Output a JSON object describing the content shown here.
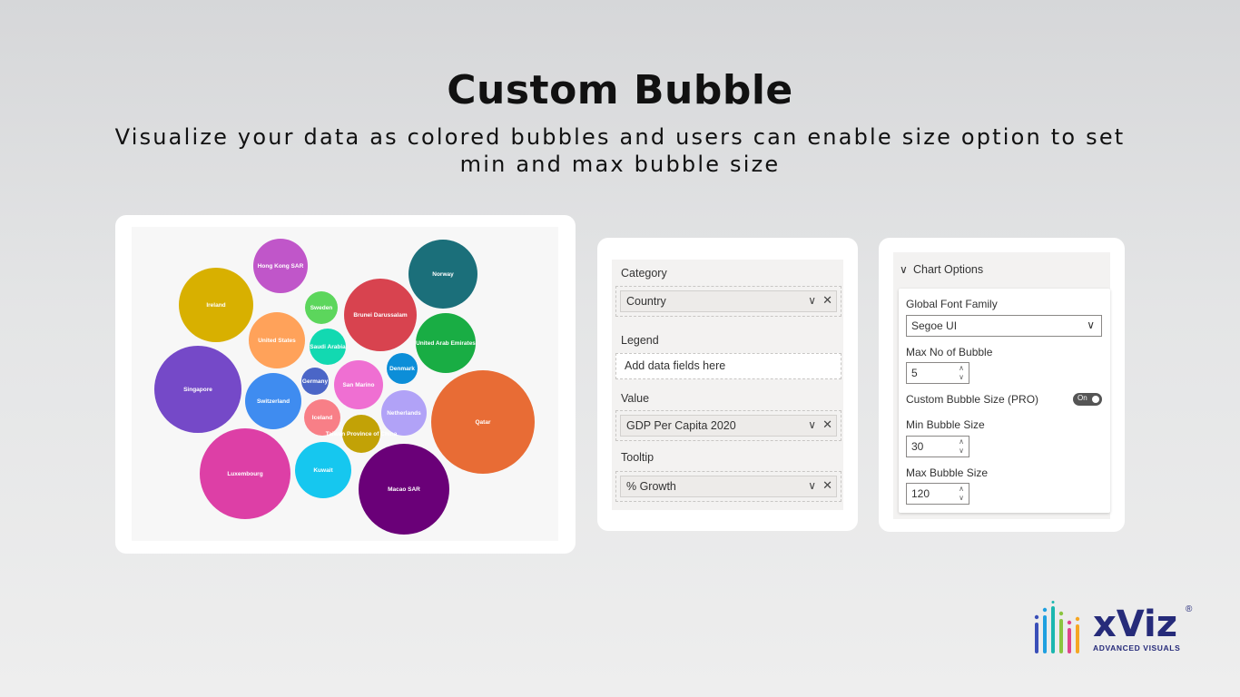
{
  "header": {
    "title": "Custom Bubble",
    "subtitle": "Visualize your data as colored bubbles and users can enable size option to set min and max bubble size"
  },
  "chart_data": {
    "type": "bubble",
    "bubbles": [
      {
        "label": "Hong Kong SAR",
        "color": "#c056c9"
      },
      {
        "label": "Ireland",
        "color": "#d8b000"
      },
      {
        "label": "Sweden",
        "color": "#5cd65c"
      },
      {
        "label": "Brunei Darussalam",
        "color": "#d8434f"
      },
      {
        "label": "Norway",
        "color": "#1b6f7a"
      },
      {
        "label": "United States",
        "color": "#ffa25a"
      },
      {
        "label": "Saudi Arabia",
        "color": "#12d9b1"
      },
      {
        "label": "United Arab Emirates",
        "color": "#19ad44"
      },
      {
        "label": "Singapore",
        "color": "#7549c8"
      },
      {
        "label": "Switzerland",
        "color": "#3f8cf0"
      },
      {
        "label": "Germany",
        "color": "#4b66c7"
      },
      {
        "label": "San Marino",
        "color": "#ef6fd2"
      },
      {
        "label": "Denmark",
        "color": "#0c8ed8"
      },
      {
        "label": "Netherlands",
        "color": "#b1a2f7"
      },
      {
        "label": "Qatar",
        "color": "#e86c35"
      },
      {
        "label": "Iceland",
        "color": "#f87f87"
      },
      {
        "label": "Taiwan Province of China",
        "color": "#c2a206"
      },
      {
        "label": "Luxembourg",
        "color": "#dd3fa6"
      },
      {
        "label": "Kuwait",
        "color": "#16c7ef"
      },
      {
        "label": "Macao SAR",
        "color": "#6a0078"
      }
    ]
  },
  "fields": {
    "category_label": "Category",
    "category_value": "Country",
    "legend_label": "Legend",
    "legend_placeholder": "Add data fields here",
    "value_label": "Value",
    "value_value": "GDP Per Capita 2020",
    "tooltip_label": "Tooltip",
    "tooltip_value": "% Growth"
  },
  "options": {
    "header": "Chart Options",
    "font_family_label": "Global Font Family",
    "font_family_value": "Segoe UI",
    "max_bubbles_label": "Max No of Bubble",
    "max_bubbles_value": "5",
    "custom_size_label": "Custom Bubble Size (PRO)",
    "custom_size_toggle": "On",
    "min_size_label": "Min Bubble Size",
    "min_size_value": "30",
    "max_size_label": "Max Bubble Size",
    "max_size_value": "120"
  },
  "logo": {
    "name": "xViz",
    "tagline": "ADVANCED  VISUALS",
    "reg": "®"
  }
}
